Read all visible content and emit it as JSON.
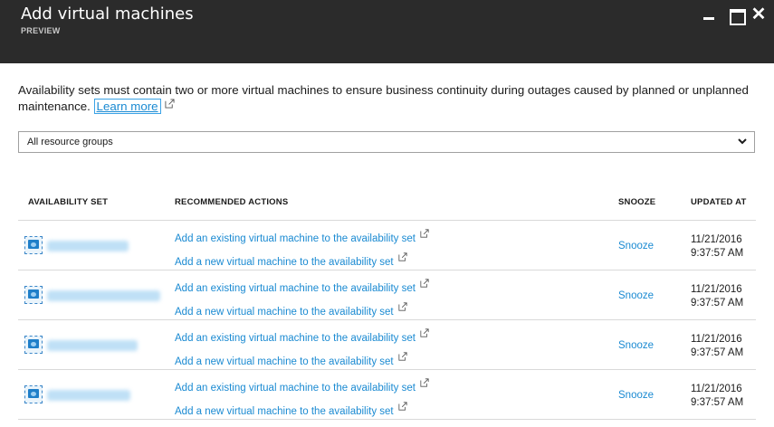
{
  "window": {
    "title": "Add virtual machines",
    "subtitle": "PREVIEW",
    "minimize_icon": "minimize-icon",
    "maximize_icon": "maximize-icon",
    "close_icon": "close-icon"
  },
  "description": {
    "text": "Availability sets must contain two or more virtual machines to ensure business continuity during outages caused by planned or unplanned maintenance.",
    "link_label": "Learn more",
    "link_icon": "external-link-icon"
  },
  "filter": {
    "selected": "All resource groups",
    "icon": "chevron-down-icon"
  },
  "table": {
    "headers": {
      "availability_set": "AVAILABILITY SET",
      "recommended_actions": "RECOMMENDED ACTIONS",
      "snooze": "SNOOZE",
      "updated_at": "UPDATED AT"
    },
    "rows": [
      {
        "availability_set": "",
        "action_existing": "Add an existing virtual machine to the availability set",
        "action_new": "Add a new virtual machine to the availability set",
        "snooze": "Snooze",
        "updated_date": "11/21/2016",
        "updated_time": "9:37:57 AM"
      },
      {
        "availability_set": "",
        "action_existing": "Add an existing virtual machine to the availability set",
        "action_new": "Add a new virtual machine to the availability set",
        "snooze": "Snooze",
        "updated_date": "11/21/2016",
        "updated_time": "9:37:57 AM"
      },
      {
        "availability_set": "",
        "action_existing": "Add an existing virtual machine to the availability set",
        "action_new": "Add a new virtual machine to the availability set",
        "snooze": "Snooze",
        "updated_date": "11/21/2016",
        "updated_time": "9:37:57 AM"
      },
      {
        "availability_set": "",
        "action_existing": "Add an existing virtual machine to the availability set",
        "action_new": "Add a new virtual machine to the availability set",
        "snooze": "Snooze",
        "updated_date": "11/21/2016",
        "updated_time": "9:37:57 AM"
      }
    ]
  },
  "colors": {
    "titlebar": "#2b2b2b",
    "link": "#1a8ad2",
    "divider": "#d9d9d9"
  }
}
